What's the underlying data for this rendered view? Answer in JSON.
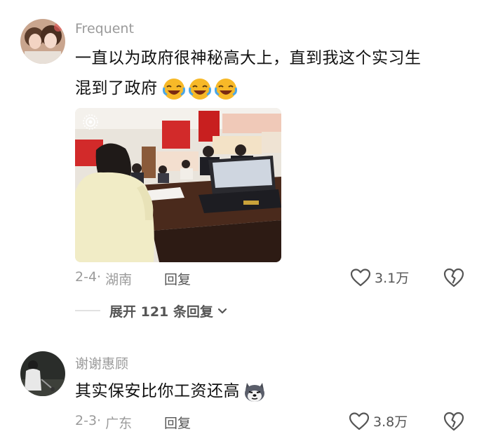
{
  "comments": [
    {
      "username": "Frequent",
      "text_line1": "一直以为政府很神秘高大上，直到我这个实习生",
      "text_line2": "混到了政府",
      "emojis": [
        "laughing-crying-emoji",
        "laughing-crying-emoji",
        "laughing-crying-emoji"
      ],
      "date": "2-4·",
      "location": "湖南",
      "reply_label": "回复",
      "likes": "3.1万",
      "expand_label": "展开 121 条回复"
    },
    {
      "username": "谢谢惠顾",
      "text": "其实保安比你工资还高",
      "emoji": "husky-dog-emoji",
      "date": "2-3·",
      "location": "广东",
      "reply_label": "回复",
      "likes": "3.8万"
    }
  ],
  "icons": {
    "like": "heart-outline-icon",
    "dislike": "broken-heart-icon",
    "expand": "chevron-down-icon",
    "live_photo": "live-photo-icon"
  }
}
